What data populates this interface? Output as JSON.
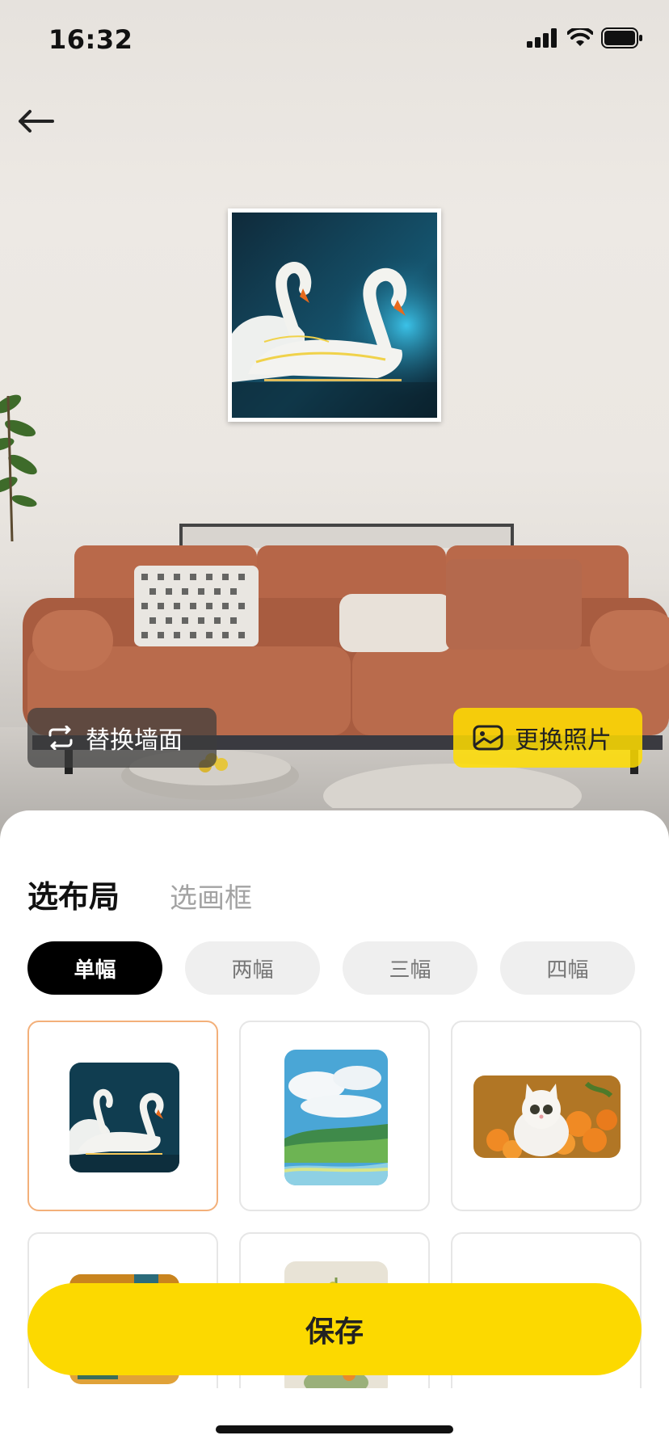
{
  "status_bar": {
    "time": "16:32"
  },
  "actions": {
    "replace_wall": "替换墙面",
    "change_photo": "更换照片"
  },
  "tabs": {
    "layout": "选布局",
    "frame": "选画框"
  },
  "layout_options": [
    {
      "label": "单幅",
      "selected": true
    },
    {
      "label": "两幅",
      "selected": false
    },
    {
      "label": "三幅",
      "selected": false
    },
    {
      "label": "四幅",
      "selected": false
    }
  ],
  "photos": [
    {
      "name": "swan-photo",
      "selected": true
    },
    {
      "name": "landscape-photo",
      "selected": false
    },
    {
      "name": "kitten-photo",
      "selected": false
    },
    {
      "name": "painting-photo",
      "selected": false
    },
    {
      "name": "flower-photo",
      "selected": false
    },
    {
      "name": "empty-photo",
      "selected": false
    }
  ],
  "save_label": "保存",
  "colors": {
    "accent": "#fcd900",
    "selected_border": "#f3b07a",
    "chip_active": "#000000",
    "sofa": "#b9694a"
  }
}
